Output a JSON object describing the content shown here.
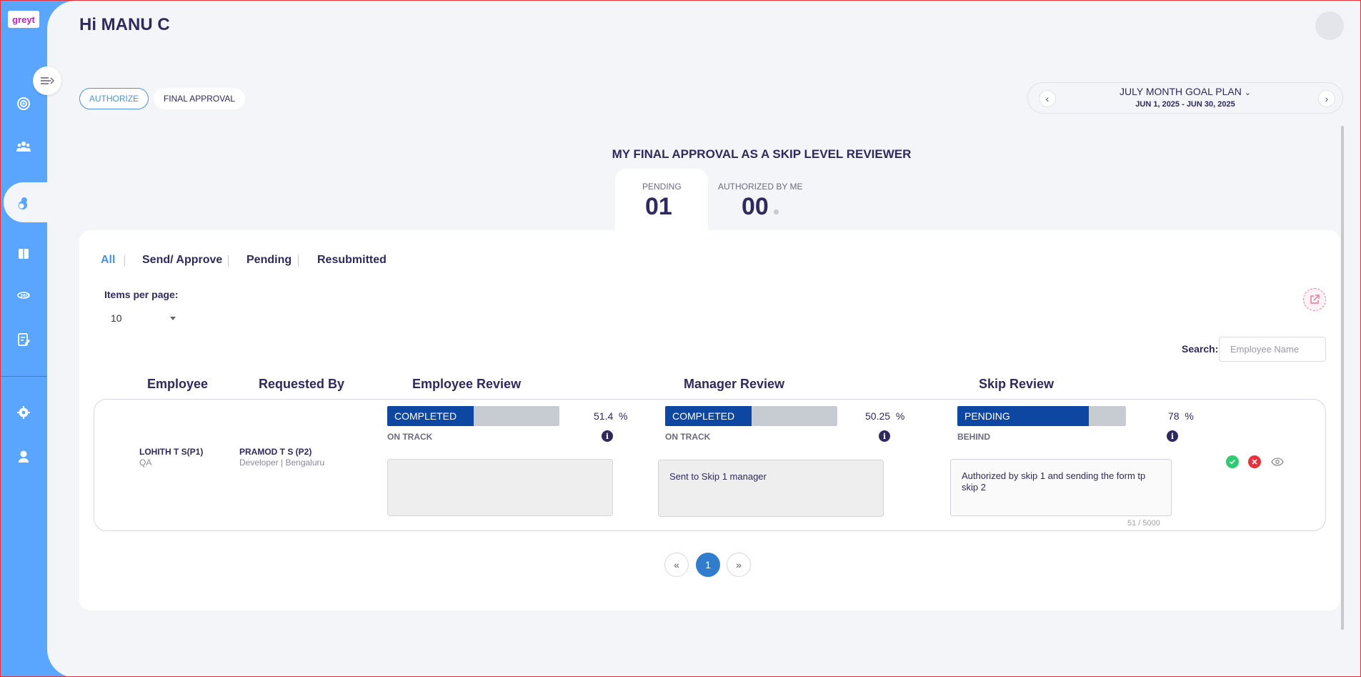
{
  "app": {
    "logo_text": "greyt"
  },
  "header": {
    "greeting": "Hi MANU C"
  },
  "view_tabs": [
    {
      "label": "AUTHORIZE",
      "active": true
    },
    {
      "label": "FINAL APPROVAL",
      "active": false
    }
  ],
  "plan": {
    "title": "JULY MONTH GOAL PLAN",
    "range": "JUN 1, 2025 - JUN 30, 2025"
  },
  "page_heading": "MY FINAL APPROVAL AS A SKIP LEVEL REVIEWER",
  "stats": {
    "pending_label": "PENDING",
    "pending_value": "01",
    "authorized_label": "AUTHORIZED BY ME",
    "authorized_value": "00"
  },
  "filter_tabs": [
    "All",
    "Send/ Approve",
    "Pending",
    "Resubmitted"
  ],
  "pagination": {
    "items_label": "Items per page:",
    "items_value": "10",
    "prev": "«",
    "current": "1",
    "next": "»"
  },
  "search": {
    "label": "Search:",
    "placeholder": "Employee Name"
  },
  "columns": {
    "employee": "Employee",
    "requested_by": "Requested By",
    "employee_review": "Employee Review",
    "manager_review": "Manager Review",
    "skip_review": "Skip Review"
  },
  "row": {
    "employee_name": "LOHITH T S(P1)",
    "employee_dept": "QA",
    "requester_name": "PRAMOD T S (P2)",
    "requester_meta": "Developer | Bengaluru",
    "employee_review": {
      "status": "COMPLETED",
      "progress": 0.5,
      "percent": "51.4",
      "unit": "%",
      "track": "ON TRACK",
      "comment": ""
    },
    "manager_review": {
      "status": "COMPLETED",
      "progress": 0.5,
      "percent": "50.25",
      "unit": "%",
      "track": "ON TRACK",
      "comment": "Sent to Skip 1 manager"
    },
    "skip_review": {
      "status": "PENDING",
      "progress": 0.78,
      "percent": "78",
      "unit": "%",
      "track": "BEHIND",
      "comment": "Authorized by skip 1 and sending the form tp skip 2",
      "counter": "51 / 5000"
    }
  },
  "colors": {
    "sidebar": "#5aa6ff",
    "accent": "#4a90e2",
    "bar_fill": "#0d47a1",
    "approve": "#2ecc71",
    "reject": "#e8323c"
  }
}
